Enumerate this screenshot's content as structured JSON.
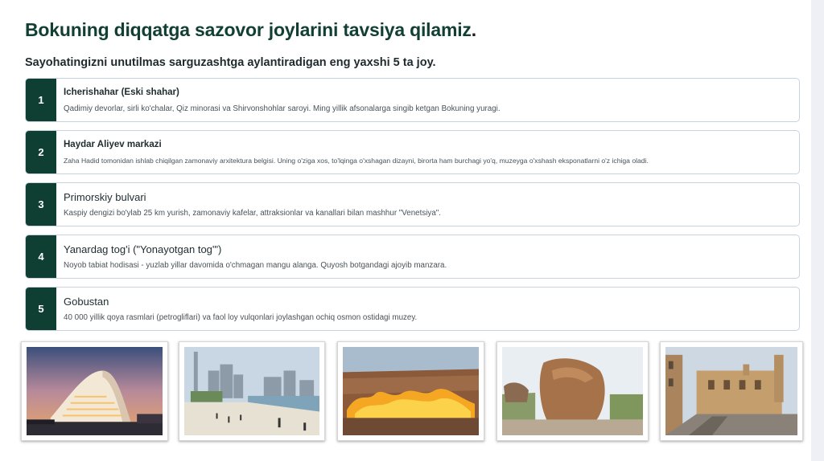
{
  "header": {
    "title": "Bokuning diqqatga sazovor joylarini tavsiya qilamiz",
    "title_punct": ".",
    "subtitle": "Sayohatingizni unutilmas sarguzashtga aylantiradigan eng yaxshi 5 ta joy."
  },
  "places": [
    {
      "num": "1",
      "title": "Icherishahar (Eski shahar)",
      "desc": "Qadimiy devorlar, sirli ko'chalar, Qiz minorasi va Shirvonshohlar saroyi. Ming yillik afsonalarga singib ketgan Bokuning yuragi."
    },
    {
      "num": "2",
      "title": "Haydar Aliyev markazi",
      "desc": "Zaha Hadid tomonidan ishlab chiqilgan zamonaviy arxitektura belgisi. Uning o'ziga xos, to'lqinga o'xshagan dizayni, birorta ham burchagi yo'q, muzeyga o'xshash eksponatlarni o'z ichiga oladi."
    },
    {
      "num": "3",
      "title": "Primorskiy bulvari",
      "desc": "Kaspiy dengizi bo'ylab 25 km yurish, zamonaviy kafelar, attraksionlar va kanallari bilan mashhur \"Venetsiya\"."
    },
    {
      "num": "4",
      "title": "Yanardag tog'i (\"Yonayotgan tog'\")",
      "desc": "Noyob tabiat hodisasi - yuzlab yillar davomida o'chmagan mangu alanga. Quyosh botgandagi ajoyib manzara."
    },
    {
      "num": "5",
      "title": "Gobustan",
      "desc": "40 000 yillik qoya rasmlari (petrogliflari) va faol loy vulqonlari joylashgan ochiq osmon ostidagi muzey."
    }
  ],
  "colors": {
    "accent": "#0f3f33",
    "title": "#113f33",
    "card_border": "#c9d2e0"
  }
}
